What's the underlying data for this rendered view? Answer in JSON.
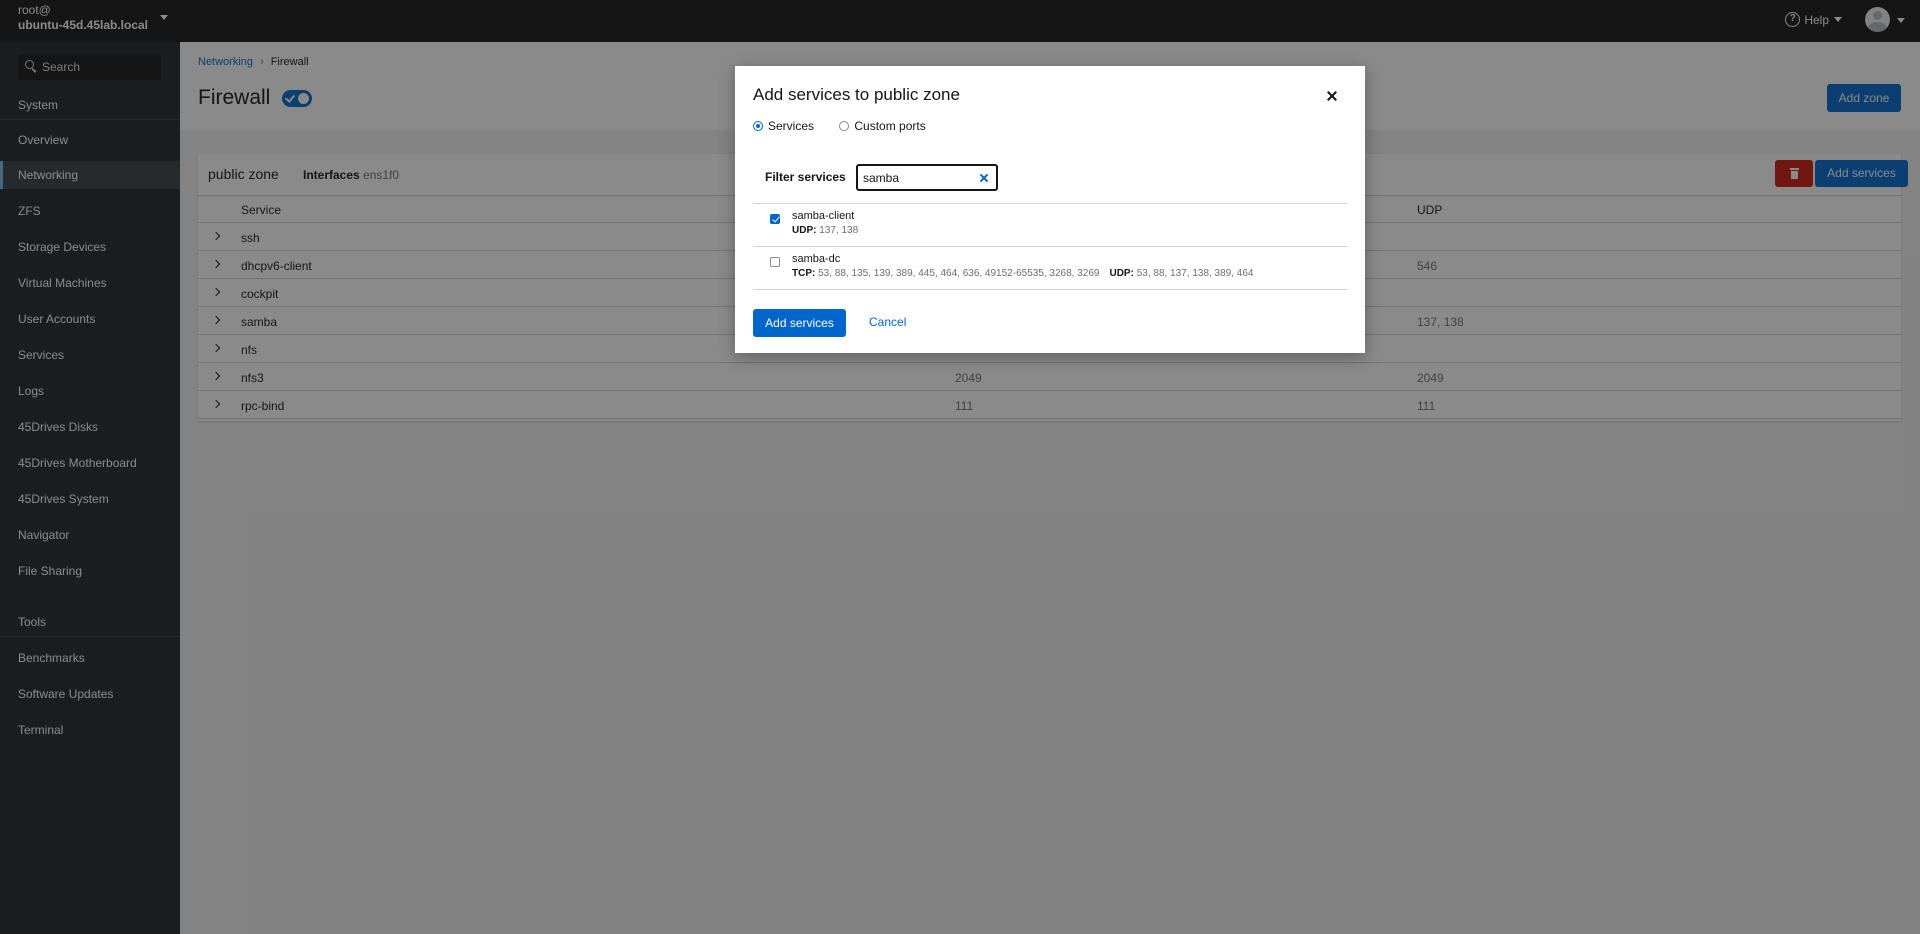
{
  "host": {
    "user": "root@",
    "name": "ubuntu-45d.45lab.local"
  },
  "sidebar": {
    "search_placeholder": "Search",
    "system_header": "System",
    "items": [
      {
        "label": "Overview"
      },
      {
        "label": "Networking",
        "active": true
      },
      {
        "label": "ZFS"
      },
      {
        "label": "Storage Devices"
      },
      {
        "label": "Virtual Machines"
      },
      {
        "label": "User Accounts"
      },
      {
        "label": "Services"
      },
      {
        "label": "Logs"
      },
      {
        "label": "45Drives Disks"
      },
      {
        "label": "45Drives Motherboard"
      },
      {
        "label": "45Drives System"
      },
      {
        "label": "Navigator"
      },
      {
        "label": "File Sharing"
      }
    ],
    "tools_header": "Tools",
    "tools": [
      {
        "label": "Benchmarks"
      },
      {
        "label": "Software Updates"
      },
      {
        "label": "Terminal"
      }
    ]
  },
  "topbar": {
    "help_label": "Help"
  },
  "page": {
    "breadcrumb": [
      "Networking",
      "Firewall"
    ],
    "title": "Firewall",
    "add_zone_label": "Add zone"
  },
  "zone": {
    "title": "public zone",
    "interfaces_label": "Interfaces",
    "interfaces_value": "ens1f0",
    "add_services_label": "Add services",
    "columns": [
      "Service",
      "UDP"
    ],
    "rows": [
      {
        "service": "ssh",
        "tcp": "",
        "udp": ""
      },
      {
        "service": "dhcpv6-client",
        "tcp": "",
        "udp": "546"
      },
      {
        "service": "cockpit",
        "tcp": "",
        "udp": ""
      },
      {
        "service": "samba",
        "tcp": "",
        "udp": "137, 138"
      },
      {
        "service": "nfs",
        "tcp": "",
        "udp": ""
      },
      {
        "service": "nfs3",
        "tcp": "2049",
        "udp": "2049"
      },
      {
        "service": "rpc-bind",
        "tcp": "111",
        "udp": "111"
      }
    ]
  },
  "modal": {
    "title": "Add services to public zone",
    "radio_services": "Services",
    "radio_custom": "Custom ports",
    "filter_label": "Filter services",
    "filter_value": "samba",
    "services": [
      {
        "name": "samba-client",
        "checked": true,
        "udp_label": "UDP:",
        "udp": "137, 138",
        "tcp_label": "",
        "tcp": ""
      },
      {
        "name": "samba-dc",
        "checked": false,
        "tcp_label": "TCP:",
        "tcp": "53, 88, 135, 139, 389, 445, 464, 636, 49152-65535, 3268, 3269",
        "udp_label": "UDP:",
        "udp": "53, 88, 137, 138, 389, 464"
      }
    ],
    "add_button": "Add services",
    "cancel_button": "Cancel"
  }
}
